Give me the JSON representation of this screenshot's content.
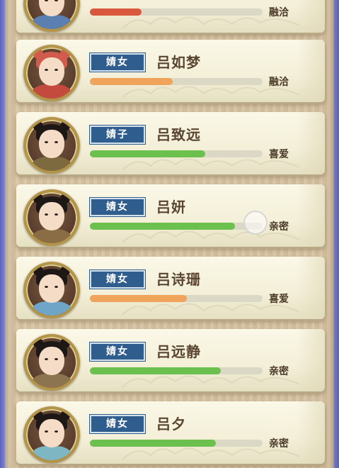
{
  "characters": [
    {
      "title": "",
      "name": "",
      "relation": "融洽",
      "affection": 0.3,
      "color": "#d9573c",
      "hair": "#1d1816",
      "robe": "#5a7fb0"
    },
    {
      "title": "婧女",
      "name": "吕如梦",
      "relation": "融洽",
      "affection": 0.48,
      "color": "#f0a35a",
      "hair": "#d15c4d",
      "robe": "#c44a3e"
    },
    {
      "title": "婧子",
      "name": "吕致远",
      "relation": "喜爱",
      "affection": 0.67,
      "color": "#6cc14e",
      "hair": "#1d1816",
      "robe": "#7d6a3e"
    },
    {
      "title": "婧女",
      "name": "吕妍",
      "relation": "亲密",
      "affection": 0.84,
      "color": "#6cc14e",
      "hair": "#1d1816",
      "robe": "#8a6d44"
    },
    {
      "title": "婧女",
      "name": "吕诗珊",
      "relation": "喜爱",
      "affection": 0.56,
      "color": "#f0a35a",
      "hair": "#1d1816",
      "robe": "#6fa6c8"
    },
    {
      "title": "婧女",
      "name": "吕远静",
      "relation": "亲密",
      "affection": 0.76,
      "color": "#6cc14e",
      "hair": "#1d1816",
      "robe": "#8d7450"
    },
    {
      "title": "婧女",
      "name": "吕夕",
      "relation": "亲密",
      "affection": 0.73,
      "color": "#6cc14e",
      "hair": "#1d1816",
      "robe": "#7fb6c4"
    }
  ]
}
